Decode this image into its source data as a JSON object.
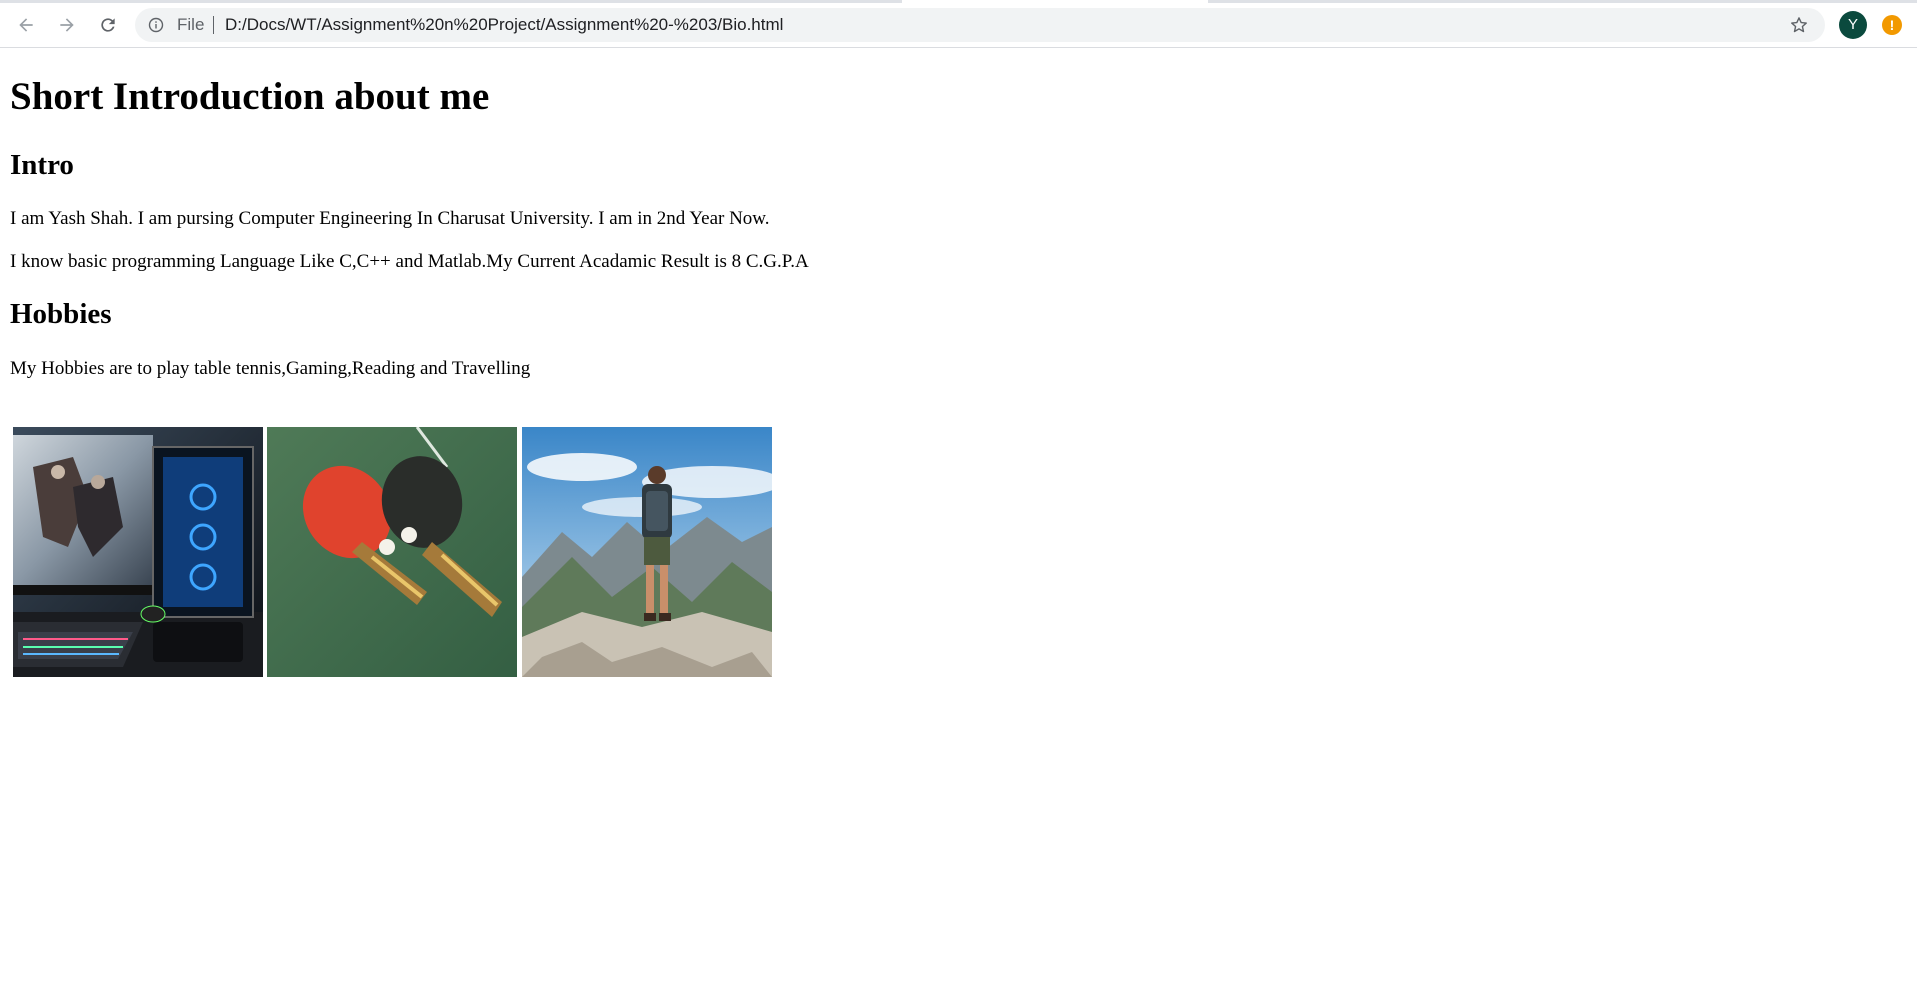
{
  "browser": {
    "address_scheme": "File",
    "address_url": "D:/Docs/WT/Assignment%20n%20Project/Assignment%20-%203/Bio.html",
    "profile_initial": "Y",
    "alert_glyph": "!",
    "profile_color": "#0b4a3e",
    "alert_color": "#f29900"
  },
  "page": {
    "title": "Short Introduction about me",
    "intro_heading": "Intro",
    "intro_line_1": "I am Yash Shah. I am pursing Computer Engineering In Charusat University. I am in 2nd Year Now.",
    "intro_line_2": "I know basic programming Language Like C,C++ and Matlab.My Current Acadamic Result is 8 C.G.P.A",
    "hobbies_heading": "Hobbies",
    "hobbies_line": "My Hobbies are to play table tennis,Gaming,Reading and Travelling",
    "images": [
      {
        "subject": "gaming-pc"
      },
      {
        "subject": "table-tennis-paddles"
      },
      {
        "subject": "hiker-mountains"
      }
    ]
  }
}
